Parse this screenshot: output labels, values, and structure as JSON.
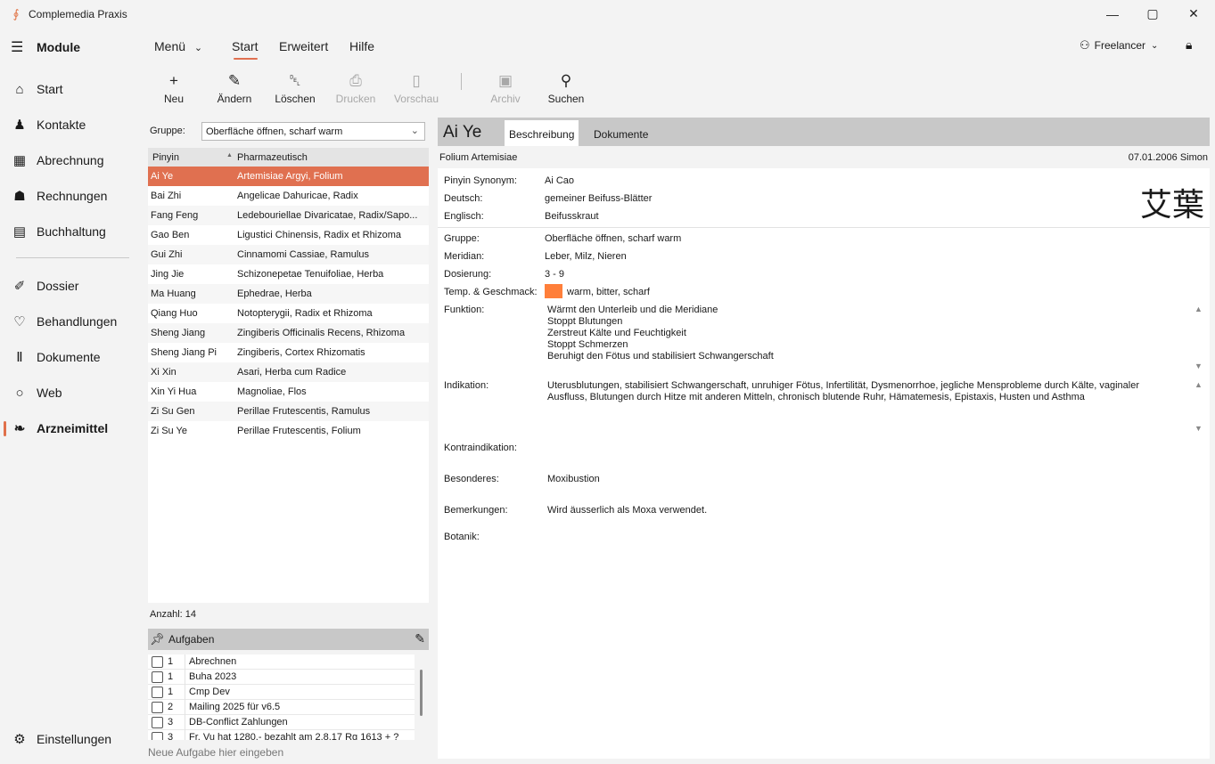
{
  "window": {
    "title": "Complemedia Praxis",
    "minimize": "—",
    "maximize": "▢",
    "close": "✕"
  },
  "nav": {
    "heading": "Module",
    "items": [
      {
        "label": "Start",
        "icon": "home-icon",
        "glyph": "⌂"
      },
      {
        "label": "Kontakte",
        "icon": "person-icon",
        "glyph": "♟"
      },
      {
        "label": "Abrechnung",
        "icon": "calculator-icon",
        "glyph": "▦"
      },
      {
        "label": "Rechnungen",
        "icon": "bank-icon",
        "glyph": "☗"
      },
      {
        "label": "Buchhaltung",
        "icon": "book-icon",
        "glyph": "▤"
      },
      {
        "label": "Dossier",
        "icon": "dossier-icon",
        "glyph": "✐"
      },
      {
        "label": "Behandlungen",
        "icon": "heartbeat-icon",
        "glyph": "♡"
      },
      {
        "label": "Dokumente",
        "icon": "books-icon",
        "glyph": "Ⅱ"
      },
      {
        "label": "Web",
        "icon": "globe-icon",
        "glyph": "○"
      },
      {
        "label": "Arzneimittel",
        "icon": "leaf-icon",
        "glyph": "❧"
      }
    ],
    "settings": "Einstellungen"
  },
  "menu": {
    "items": [
      "Menü",
      "Start",
      "Erweitert",
      "Hilfe"
    ],
    "menu_chevron": "⌄",
    "user": "Freelancer"
  },
  "toolbar": [
    {
      "label": "Neu",
      "glyph": "+",
      "icon": "plus-icon",
      "enabled": true
    },
    {
      "label": "Ändern",
      "glyph": "✎",
      "icon": "pencil-icon",
      "enabled": true
    },
    {
      "label": "Löschen",
      "glyph": "␡",
      "icon": "trash-icon",
      "enabled": true
    },
    {
      "label": "Drucken",
      "glyph": "⎙",
      "icon": "printer-icon",
      "enabled": false
    },
    {
      "label": "Vorschau",
      "glyph": "▯",
      "icon": "document-icon",
      "enabled": false
    },
    {
      "label": "Archiv",
      "glyph": "▣",
      "icon": "archive-icon",
      "enabled": false
    },
    {
      "label": "Suchen",
      "glyph": "⚲",
      "icon": "search-icon",
      "enabled": true
    }
  ],
  "filter": {
    "label": "Gruppe:",
    "value": "Oberfläche öffnen, scharf warm"
  },
  "list": {
    "headers": [
      "Pinyin",
      "Pharmazeutisch"
    ],
    "rows": [
      [
        "Ai Ye",
        "Artemisiae Argyi, Folium"
      ],
      [
        "Bai Zhi",
        "Angelicae Dahuricae, Radix"
      ],
      [
        "Fang Feng",
        "Ledebouriellae Divaricatae, Radix/Sapo..."
      ],
      [
        "Gao Ben",
        "Ligustici Chinensis, Radix et Rhizoma"
      ],
      [
        "Gui Zhi",
        "Cinnamomi Cassiae, Ramulus"
      ],
      [
        "Jing Jie",
        "Schizonepetae Tenuifoliae, Herba"
      ],
      [
        "Ma Huang",
        "Ephedrae, Herba"
      ],
      [
        "Qiang Huo",
        "Notopterygii, Radix et Rhizoma"
      ],
      [
        "Sheng Jiang",
        "Zingiberis Officinalis Recens, Rhizoma"
      ],
      [
        "Sheng Jiang Pi",
        "Zingiberis, Cortex Rhizomatis"
      ],
      [
        "Xi Xin",
        "Asari, Herba cum Radice"
      ],
      [
        "Xin Yi Hua",
        "Magnoliae, Flos"
      ],
      [
        "Zi Su Gen",
        "Perillae Frutescentis, Ramulus"
      ],
      [
        "Zi Su Ye",
        "Perillae Frutescentis, Folium"
      ]
    ],
    "count": "Anzahl: 14"
  },
  "tasks": {
    "title": "Aufgaben",
    "items": [
      [
        "1",
        "Abrechnen"
      ],
      [
        "1",
        "Buha 2023"
      ],
      [
        "1",
        "Cmp Dev"
      ],
      [
        "2",
        "Mailing 2025 für v6.5"
      ],
      [
        "3",
        "DB-Conflict Zahlungen"
      ],
      [
        "3",
        "Fr. Vu hat 1280.- bezahlt am 2.8.17 Rg 1613 + ?"
      ]
    ],
    "new_placeholder": "Neue Aufgabe hier eingeben"
  },
  "detail": {
    "title": "Ai Ye",
    "tabs": [
      "Beschreibung",
      "Dokumente"
    ],
    "subtitle": "Folium Artemisiae",
    "meta": "07.01.2006  Simon",
    "hanzi": "艾葉",
    "fields": {
      "pinyin_syn_label": "Pinyin Synonym:",
      "pinyin_syn": "Ai Cao",
      "deutsch_label": "Deutsch:",
      "deutsch": "gemeiner Beifuss-Blätter",
      "englisch_label": "Englisch:",
      "englisch": "Beifusskraut",
      "gruppe_label": "Gruppe:",
      "gruppe": "Oberfläche öffnen, scharf warm",
      "meridian_label": "Meridian:",
      "meridian": "Leber, Milz, Nieren",
      "dosierung_label": "Dosierung:",
      "dosierung": "3 - 9",
      "temp_label": "Temp. & Geschmack:",
      "temp": "warm, bitter, scharf",
      "temp_color": "#ff7f3a",
      "funktion_label": "Funktion:",
      "funktion": "Wärmt den Unterleib und die Meridiane\nStoppt Blutungen\nZerstreut Kälte und Feuchtigkeit\nStoppt Schmerzen\nBeruhigt den Fötus und stabilisiert Schwangerschaft",
      "indikation_label": "Indikation:",
      "indikation": "Uterusblutungen, stabilisiert Schwangerschaft, unruhiger Fötus, Infertilität, Dysmenorrhoe, jegliche Mensprobleme durch Kälte, vaginaler\nAusfluss, Blutungen durch Hitze mit anderen Mitteln, chronisch blutende Ruhr, Hämatemesis, Epistaxis, Husten und Asthma",
      "kontra_label": "Kontraindikation:",
      "besonderes_label": "Besonderes:",
      "besonderes": "Moxibustion",
      "bemerkungen_label": "Bemerkungen:",
      "bemerkungen": "Wird äusserlich als Moxa verwendet.",
      "botanik_label": "Botanik:"
    }
  },
  "colors": {
    "accent": "#e07050"
  }
}
